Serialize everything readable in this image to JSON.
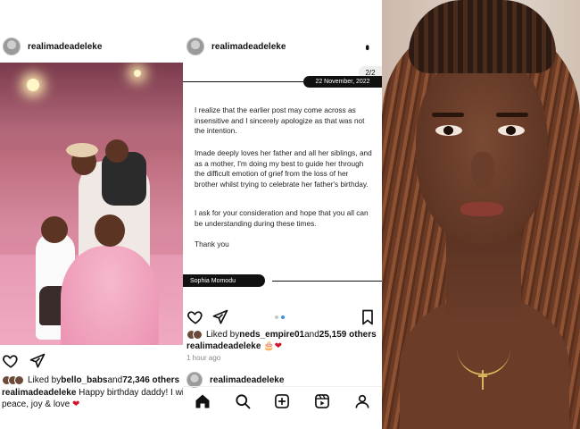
{
  "left_post": {
    "username": "realimadeadeleke",
    "liked_by_prefix": "Liked by ",
    "liked_by_user": "bello_babs",
    "liked_by_mid": " and ",
    "liked_by_count": "72,346 others",
    "caption_user": "realimadeadeleke",
    "caption_text": "Happy birthday daddy! I wis",
    "caption_line2": "peace, joy & love",
    "caption_emoji": "❤"
  },
  "middle_post": {
    "username": "realimadeadeleke",
    "more_label": "⋯",
    "page_indicator": "2/2",
    "date": "22 November, 2022",
    "paragraphs": [
      "I realize that the earlier post may come across as insensitive and I sincerely apologize as that was not the intention.",
      "Imade deeply loves her father and all her siblings, and as a mother, I'm doing my best to guide her through the difficult emotion of grief from the loss of her brother whilst trying to celebrate her father's birthday.",
      "I ask for your consideration and hope that you all can be understanding during these times.",
      "Thank you"
    ],
    "signature": "Sophia Momodu",
    "liked_by_prefix": "Liked by ",
    "liked_by_user": "neds_empire01",
    "liked_by_mid": " and ",
    "liked_by_count": "25,159 others",
    "caption_user": "realimadeadeleke",
    "caption_emoji": "🎂❤",
    "time_ago": "1 hour ago",
    "next_username": "realimadeadeleke"
  },
  "icons": {
    "heart": "heart-icon",
    "share": "send-icon",
    "bookmark": "bookmark-icon",
    "home": "home-icon",
    "search": "search-icon",
    "add": "add-post-icon",
    "reels": "reels-icon",
    "profile": "profile-icon"
  },
  "colors": {
    "accent_blue": "#3b8fe8",
    "heart_red": "#d0142c",
    "text": "#111111"
  }
}
